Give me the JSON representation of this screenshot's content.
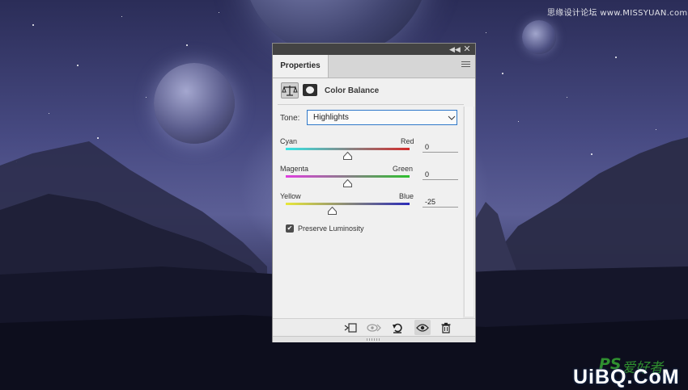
{
  "watermark": {
    "top_text": "思缘设计论坛 www.MISSYUAN.com",
    "logo_script": "PS",
    "logo_hand": "爱好者",
    "logo_brand": "UiBQ.CoM"
  },
  "panel": {
    "tab_label": "Properties",
    "heading": "Color Balance",
    "tone_label": "Tone:",
    "tone_value": "Highlights",
    "sliders": [
      {
        "left": "Cyan",
        "right": "Red",
        "value": "0",
        "level": 0
      },
      {
        "left": "Magenta",
        "right": "Green",
        "value": "0",
        "level": 0
      },
      {
        "left": "Yellow",
        "right": "Blue",
        "value": "-25",
        "level": -25
      }
    ],
    "preserve_luminosity_label": "Preserve Luminosity",
    "preserve_luminosity_checked": true,
    "icons": [
      "collapse-icon",
      "close-icon",
      "panel-menu-icon",
      "color-balance-icon",
      "layer-mask-icon",
      "chevron-down-icon",
      "clip-to-layer-icon",
      "view-previous-state-icon",
      "reset-icon",
      "visibility-eye-icon",
      "trash-icon"
    ]
  },
  "colors": {
    "panel_bg": "#f0f0f0",
    "titlebar": "#434343",
    "select_border": "#2f78c9"
  }
}
